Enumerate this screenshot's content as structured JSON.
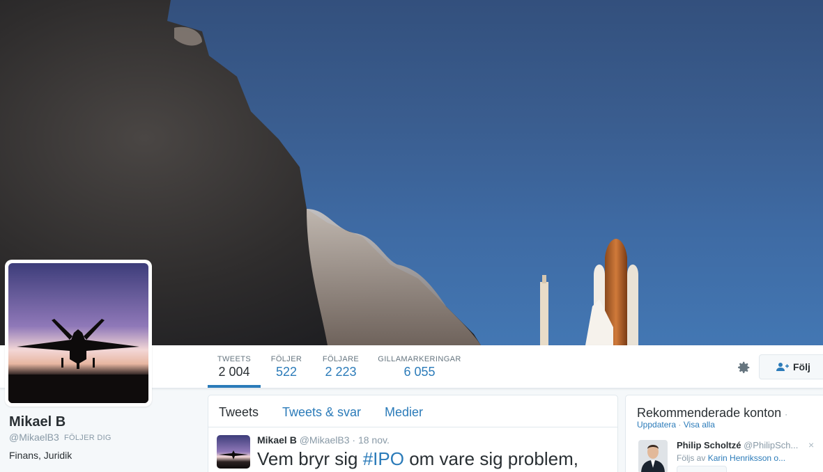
{
  "profile": {
    "name": "Mikael B",
    "handle": "@MikaelB3",
    "follows_you": "FÖLJER DIG",
    "bio": "Finans, Juridik"
  },
  "stats": [
    {
      "label": "TWEETS",
      "value": "2 004"
    },
    {
      "label": "FÖLJER",
      "value": "522"
    },
    {
      "label": "FÖLJARE",
      "value": "2 223"
    },
    {
      "label": "GILLAMARKERINGAR",
      "value": "6 055"
    }
  ],
  "actions": {
    "follow_label": "Följ",
    "settings_icon": "gear-icon",
    "follow_icon": "add-user-icon"
  },
  "timeline": {
    "tabs": [
      "Tweets",
      "Tweets & svar",
      "Medier"
    ],
    "tweet": {
      "name": "Mikael B",
      "handle": "@MikaelB3",
      "dot": "·",
      "time": "18 nov.",
      "text_pre": "Vem bryr sig ",
      "hashtag": "#IPO",
      "text_post": " om vare sig problem,"
    }
  },
  "recommended": {
    "title": "Rekommenderade konton",
    "title_dot": "·",
    "refresh": "Uppdatera",
    "sep": "·",
    "view_all": "Visa alla",
    "account": {
      "name": "Philip Scholtzé",
      "handle": "@PhilipSch...",
      "followed_by_prefix": "Följs av",
      "followed_by": "Karin Henriksson o..."
    },
    "close": "×"
  },
  "colors": {
    "link": "#2b7bb9",
    "text": "#292f33",
    "muted": "#8899a6",
    "background": "#f5f8fa"
  }
}
